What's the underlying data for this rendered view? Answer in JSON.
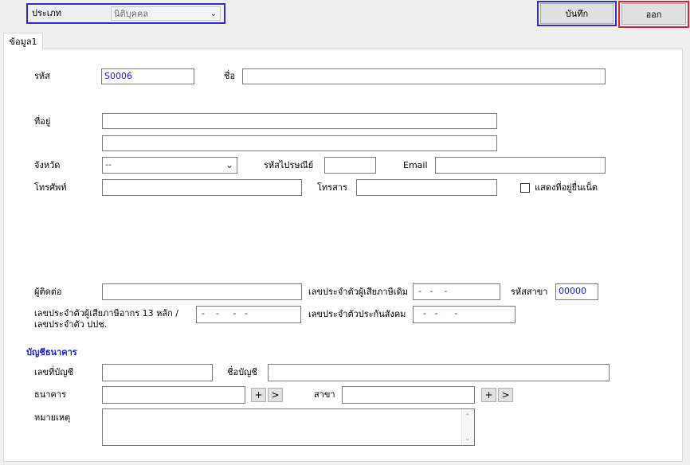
{
  "header": {
    "type_label": "ประเภท",
    "type_value": "นิติบุคคล",
    "save_label": "บันทึก",
    "exit_label": "ออก"
  },
  "tabs": [
    {
      "label": "ข้อมูล1"
    }
  ],
  "form": {
    "code_label": "รหัส",
    "code_value": "S0006",
    "name_label": "ชื่อ",
    "name_value": "",
    "address_label": "ที่อยู่",
    "address_line1": "",
    "address_line2": "",
    "province_label": "จังหวัด",
    "province_value": "--",
    "postal_label": "รหัสไปรษณีย์",
    "postal_value": "",
    "email_label": "Email",
    "email_value": "",
    "phone_label": "โทรศัพท์",
    "phone_value": "",
    "fax_label": "โทรสาร",
    "fax_value": "",
    "show_online_label": "แสดงที่อยู่ยื่นเน็ต",
    "show_online_checked": false,
    "contact_label": "ผู้ติดต่อ",
    "contact_value": "",
    "old_tax_id_label": "เลขประจำตัวผู้เสียภาษีเดิม",
    "old_tax_id_value": "-   -    -",
    "branch_code_label": "รหัสสาขา",
    "branch_code_value": "00000",
    "tax_id_13_label_line1": "เลขประจำตัวผู้เสียภาษีอากร 13 หลัก /",
    "tax_id_13_label_line2": "เลขประจำตัว ปปช.",
    "tax_id_13_value": "-    -     -   -",
    "social_security_label": "เลขประจำตัวประกันสังคม",
    "social_security_value": "-   -      -"
  },
  "bank": {
    "section_title": "บัญชีธนาคาร",
    "account_no_label": "เลขที่บัญชี",
    "account_no_value": "",
    "account_name_label": "ชื่อบัญชี",
    "account_name_value": "",
    "bank_label": "ธนาคาร",
    "bank_value": "",
    "branch_label": "สาขา",
    "branch_value": "",
    "add_symbol": "+",
    "next_symbol": ">",
    "remark_label": "หมายเหตุ",
    "remark_value": ""
  },
  "colors": {
    "highlight_blue": "#2f2fc8",
    "highlight_red": "#e0202c",
    "section_blue": "#1a1acc"
  }
}
